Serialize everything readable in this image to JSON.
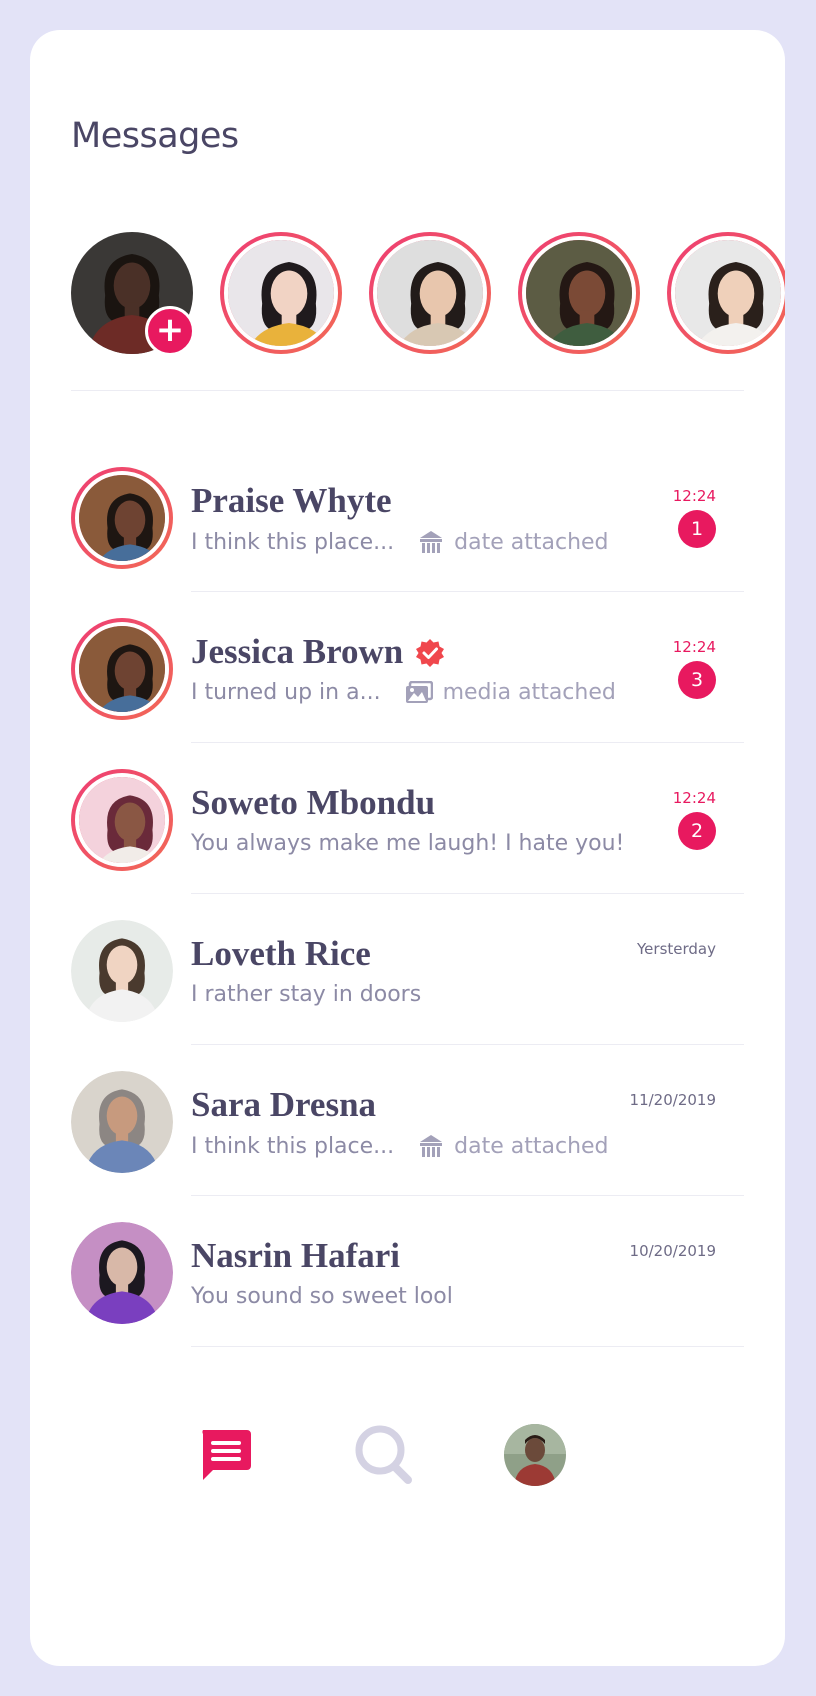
{
  "header": {
    "title": "Messages"
  },
  "stories": [
    {
      "name": "my-story",
      "own": true,
      "skin": "#4a3027",
      "hair": "#1a1410",
      "shirt": "#6d2b26",
      "bg": "#3a3836"
    },
    {
      "name": "story-2",
      "own": false,
      "skin": "#f1d3c4",
      "hair": "#1f1a1d",
      "shirt": "#e9b23b",
      "bg": "#e9e6ea"
    },
    {
      "name": "story-3",
      "own": false,
      "skin": "#e8c6ad",
      "hair": "#221b19",
      "shirt": "#d8c8b3",
      "bg": "#dedede"
    },
    {
      "name": "story-4",
      "own": false,
      "skin": "#7b4a36",
      "hair": "#241814",
      "shirt": "#3f5d3f",
      "bg": "#5c5c44"
    },
    {
      "name": "story-5",
      "own": false,
      "skin": "#efd0ba",
      "hair": "#2a201b",
      "shirt": "#f3f1ee",
      "bg": "#e8e8e8"
    }
  ],
  "conversations": [
    {
      "name": "Praise Whyte",
      "preview": "I think this place...",
      "attachment": {
        "type": "date",
        "label": "date attached"
      },
      "time": "12:24",
      "unread": "1",
      "ring": true,
      "verified": false,
      "avatar": {
        "skin": "#6e4332",
        "hair": "#1e1612",
        "shirt": "#476e9a",
        "bg": "#8a5a3a"
      }
    },
    {
      "name": "Jessica Brown",
      "preview": "I turned up in a...",
      "attachment": {
        "type": "media",
        "label": "media attached"
      },
      "time": "12:24",
      "unread": "3",
      "ring": true,
      "verified": true,
      "avatar": {
        "skin": "#6e4332",
        "hair": "#1e1612",
        "shirt": "#476e9a",
        "bg": "#8a5a3a"
      }
    },
    {
      "name": "Soweto Mbondu",
      "preview": "You always make me laugh! I hate you!",
      "attachment": null,
      "time": "12:24",
      "unread": "2",
      "ring": true,
      "verified": false,
      "avatar": {
        "skin": "#8a5744",
        "hair": "#6a2a3a",
        "shirt": "#f1ece8",
        "bg": "#f4d2dc"
      }
    },
    {
      "name": "Loveth Rice",
      "preview": "I rather stay in doors",
      "attachment": null,
      "time": "Yersterday",
      "unread": null,
      "ring": false,
      "verified": false,
      "avatar": {
        "skin": "#f0d4c2",
        "hair": "#4a3a2e",
        "shirt": "#f2f2f2",
        "bg": "#e7ebe8"
      }
    },
    {
      "name": "Sara Dresna",
      "preview": "I think this place...",
      "attachment": {
        "type": "date",
        "label": "date attached"
      },
      "time": "11/20/2019",
      "unread": null,
      "ring": false,
      "verified": false,
      "avatar": {
        "skin": "#c79a7e",
        "hair": "#8c8683",
        "shirt": "#6b86b8",
        "bg": "#d9d4cc"
      }
    },
    {
      "name": "Nasrin Hafari",
      "preview": "You sound so sweet lool",
      "attachment": null,
      "time": "10/20/2019",
      "unread": null,
      "ring": false,
      "verified": false,
      "avatar": {
        "skin": "#d8b8a8",
        "hair": "#1c1820",
        "shirt": "#7a3fbf",
        "bg": "#c58fc4"
      }
    }
  ],
  "bottom_nav": [
    {
      "id": "messages",
      "icon": "chat-icon",
      "active": true
    },
    {
      "id": "search",
      "icon": "search-icon",
      "active": false
    },
    {
      "id": "profile",
      "icon": "profile-avatar",
      "active": false
    }
  ],
  "colors": {
    "accent": "#e8195f",
    "ring_start": "#ee3d74",
    "ring_end": "#f26a55",
    "text_dark": "#4a4665",
    "text_muted": "#8c8aa5",
    "nav_inactive": "#d4d2e3"
  }
}
